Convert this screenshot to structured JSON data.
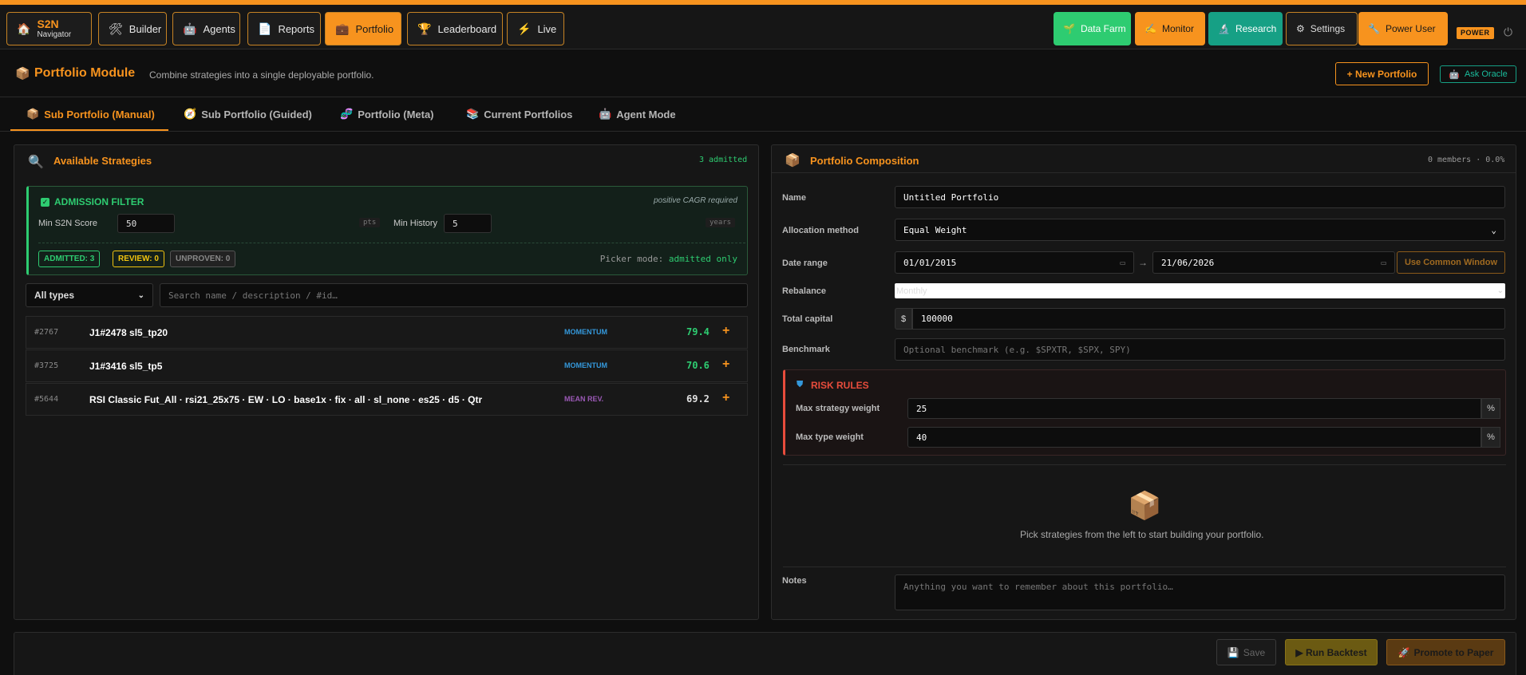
{
  "nav": {
    "brand_title": "S2N",
    "brand_sub": "Navigator",
    "items": [
      {
        "label": "Builder",
        "icon": "🛠"
      },
      {
        "label": "Agents",
        "icon": "🤖"
      },
      {
        "label": "Reports",
        "icon": "📄"
      },
      {
        "label": "Portfolio",
        "icon": "💼"
      },
      {
        "label": "Leaderboard",
        "icon": "🏆"
      },
      {
        "label": "Live",
        "icon": "⚡"
      }
    ],
    "right": [
      {
        "label": "Data Farm",
        "icon": "🌱"
      },
      {
        "label": "Monitor",
        "icon": "✍"
      },
      {
        "label": "Research",
        "icon": "🔬"
      },
      {
        "label": "Settings",
        "icon": "⚙"
      },
      {
        "label": "Power User",
        "icon": "🔧"
      }
    ],
    "power_badge": "POWER",
    "power_icon": "⏻"
  },
  "header": {
    "icon": "📦",
    "title": "Portfolio Module",
    "subtitle": "Combine strategies into a single deployable portfolio.",
    "new_portfolio": "+ New Portfolio",
    "ask_oracle": "Ask Oracle",
    "oracle_icon": "🤖"
  },
  "tabs": [
    {
      "label": "Sub Portfolio (Manual)",
      "icon": "📦"
    },
    {
      "label": "Sub Portfolio (Guided)",
      "icon": "🧭"
    },
    {
      "label": "Portfolio (Meta)",
      "icon": "🧬"
    },
    {
      "label": "Current Portfolios",
      "icon": "📚"
    },
    {
      "label": "Agent Mode",
      "icon": "🤖"
    }
  ],
  "strategies": {
    "icon": "🔍",
    "title": "Available Strategies",
    "admitted_count": "3 admitted",
    "filter": {
      "title": "ADMISSION FILTER",
      "note": "positive CAGR required",
      "min_score_label": "Min S2N Score",
      "min_score_value": "50",
      "min_score_unit": "pts",
      "min_history_label": "Min History",
      "min_history_value": "5",
      "min_history_unit": "years",
      "admitted": "ADMITTED: 3",
      "review": "REVIEW: 0",
      "unproven": "UNPROVEN: 0",
      "picker_label": "Picker mode:",
      "picker_value": "admitted only"
    },
    "type_select": "All types",
    "search_placeholder": "Search name / description / #id…",
    "rows": [
      {
        "id": "#2767",
        "name": "J1#2478 sl5_tp20",
        "type": "MOMENTUM",
        "type_color": "#3498db",
        "score": "79.4",
        "score_color": "#2ecc71"
      },
      {
        "id": "#3725",
        "name": "J1#3416 sl5_tp5",
        "type": "MOMENTUM",
        "type_color": "#3498db",
        "score": "70.6",
        "score_color": "#2ecc71"
      },
      {
        "id": "#5644",
        "name": "RSI Classic Fut_All · rsi21_25x75 · EW · LO · base1x · fix · all · sl_none · es25 · d5 · Qtr",
        "type": "MEAN REV.",
        "type_color": "#9b59b6",
        "score": "69.2",
        "score_color": "#e0e0e0"
      }
    ]
  },
  "composition": {
    "icon": "📦",
    "title": "Portfolio Composition",
    "summary": "0 members · 0.0%",
    "name_label": "Name",
    "name_value": "Untitled Portfolio",
    "alloc_label": "Allocation method",
    "alloc_value": "Equal Weight",
    "date_label": "Date range",
    "date_from": "01/01/2015",
    "date_to": "21/06/2026",
    "date_sep": "→",
    "common_window": "Use Common Window",
    "rebalance_label": "Rebalance",
    "rebalance_value": "Monthly",
    "capital_label": "Total capital",
    "capital_prefix": "$",
    "capital_value": "100000",
    "benchmark_label": "Benchmark",
    "benchmark_placeholder": "Optional benchmark (e.g. $SPXTR, $SPX, SPY)",
    "risk": {
      "title": "RISK RULES",
      "max_strategy_label": "Max strategy weight",
      "max_strategy_value": "25",
      "max_type_label": "Max type weight",
      "max_type_value": "40",
      "unit": "%"
    },
    "empty_icon": "📦",
    "empty_text": "Pick strategies from the left to start building your portfolio.",
    "notes_label": "Notes",
    "notes_placeholder": "Anything you want to remember about this portfolio…"
  },
  "footer": {
    "save": "Save",
    "save_icon": "💾",
    "run_backtest": "▶ Run Backtest",
    "promote": "Promote to Paper",
    "promote_icon": "🚀"
  },
  "colors": {
    "accent": "#f7931e",
    "success": "#2ecc71",
    "danger": "#e74c3c",
    "teal": "#16a085"
  }
}
